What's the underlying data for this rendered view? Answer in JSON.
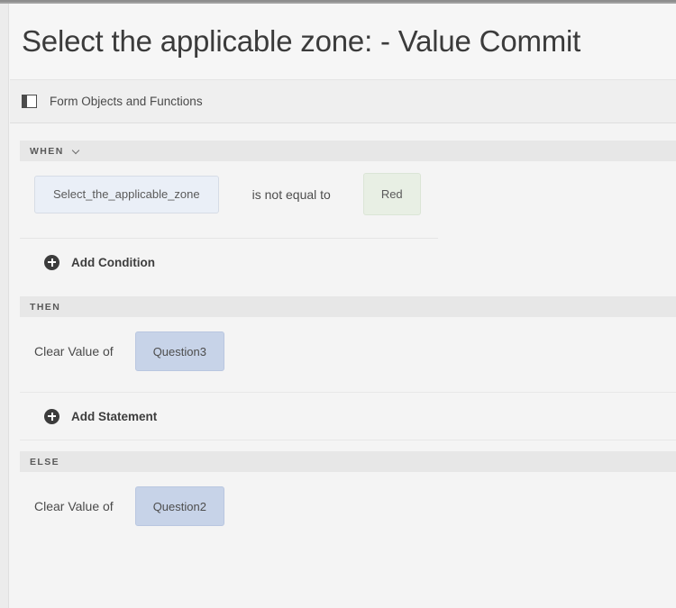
{
  "header": {
    "title": "Select the applicable zone: - Value Commit"
  },
  "toolbar": {
    "panel_icon": "panel-layout-icon",
    "label": "Form Objects and Functions"
  },
  "sections": {
    "when": {
      "band_label": "WHEN",
      "chevron_icon": "chevron-down-icon",
      "condition": {
        "object": "Select_the_applicable_zone",
        "operator": "is not equal to",
        "value": "Red"
      },
      "add_label": "Add Condition",
      "add_icon": "plus-circle-icon"
    },
    "then": {
      "band_label": "THEN",
      "statement": {
        "action": "Clear Value of",
        "target": "Question3"
      },
      "add_label": "Add Statement",
      "add_icon": "plus-circle-icon"
    },
    "else": {
      "band_label": "ELSE",
      "statement": {
        "action": "Clear Value of",
        "target": "Question2"
      }
    }
  },
  "colors": {
    "page_background": "#f4f4f4",
    "band_background": "#e7e7e7",
    "chip_object": "#eaeff7",
    "chip_value": "#e8efe4",
    "chip_target": "#c7d3e8",
    "title_text": "#3b3b3b"
  }
}
